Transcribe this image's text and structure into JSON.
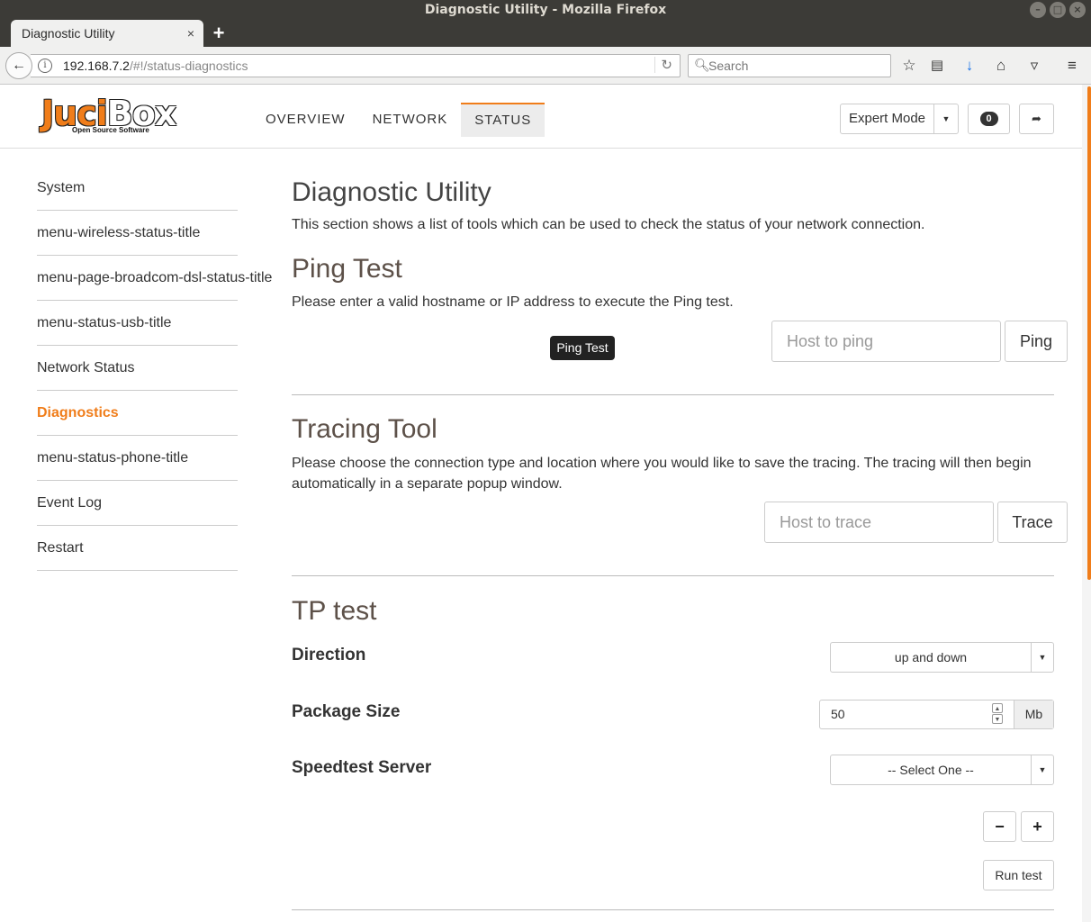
{
  "window": {
    "title": "Diagnostic Utility - Mozilla Firefox",
    "minimize": "–",
    "maximize": "□",
    "close": "×"
  },
  "tab": {
    "title": "Diagnostic Utility",
    "close": "×",
    "new_tab": "+"
  },
  "nav": {
    "url_host": "192.168.7.2",
    "url_path": "/#!/status-diagnostics",
    "search_placeholder": "Search",
    "icons": [
      "back-icon",
      "info-icon",
      "reload-icon",
      "search-icon",
      "bookmark-star-icon",
      "reading-list-icon",
      "download-icon",
      "home-icon",
      "pocket-icon",
      "menu-icon"
    ]
  },
  "header": {
    "logo_juci": "Juci",
    "logo_box": "Box",
    "logo_sub": "Open Source Software",
    "menu": [
      "OVERVIEW",
      "NETWORK",
      "STATUS"
    ],
    "active_menu": "STATUS",
    "expert_mode": "Expert Mode",
    "notifications": "0",
    "accent_color": "#f07d1a"
  },
  "sidebar": {
    "items": [
      {
        "label": "System"
      },
      {
        "label": "menu-wireless-status-title"
      },
      {
        "label": "menu-page-broadcom-dsl-status-title"
      },
      {
        "label": "menu-status-usb-title"
      },
      {
        "label": "Network Status"
      },
      {
        "label": "Diagnostics"
      },
      {
        "label": "menu-status-phone-title"
      },
      {
        "label": "Event Log"
      },
      {
        "label": "Restart"
      }
    ],
    "active": "Diagnostics"
  },
  "main": {
    "title": "Diagnostic Utility",
    "description": "This section shows a list of tools which can be used to check the status of your network connection.",
    "ping": {
      "title": "Ping Test",
      "description": "Please enter a valid hostname or IP address to execute the Ping test.",
      "placeholder": "Host to ping",
      "button": "Ping",
      "tooltip": "Ping Test"
    },
    "trace": {
      "title": "Tracing Tool",
      "description": "Please choose the connection type and location where you would like to save the tracing. The tracing will then begin automatically in a separate popup window.",
      "placeholder": "Host to trace",
      "button": "Trace"
    },
    "tp": {
      "title": "TP test",
      "direction_label": "Direction",
      "direction_value": "up and down",
      "package_label": "Package Size",
      "package_value": "50",
      "package_unit": "Mb",
      "server_label": "Speedtest Server",
      "server_value": "-- Select One --",
      "minus": "−",
      "plus": "+",
      "run": "Run test"
    }
  }
}
